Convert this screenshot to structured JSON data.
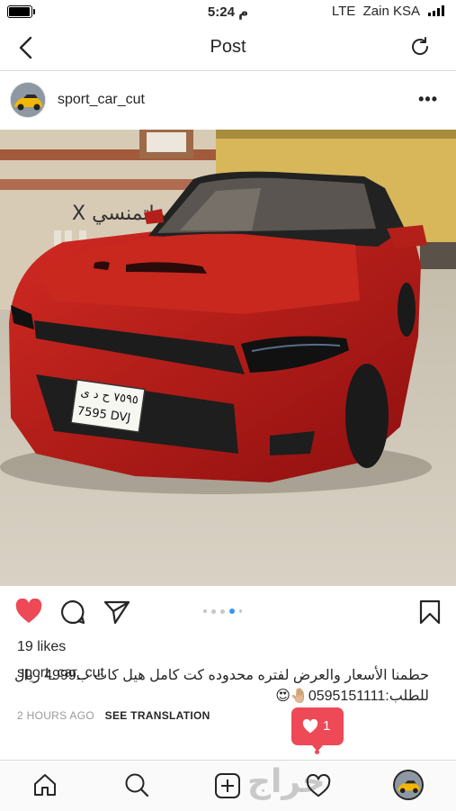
{
  "status_bar": {
    "time": "5:24 م",
    "network": "LTE",
    "carrier": "Zain KSA",
    "battery_level": 0.9
  },
  "nav": {
    "title": "Post",
    "back_icon": "chevron-left-icon",
    "refresh_icon": "refresh-icon"
  },
  "post": {
    "username": "sport_car_cut",
    "photo_plate_text": "٧٥٩٥ ح د ى",
    "photo_plate_number": "7595 DVJ",
    "photo_wall_text": "X ماتمنسي",
    "likes": "19 likes",
    "caption_user": "sport_car_cut",
    "caption_text": "حطمنا الأسعار والعرض لفتره محدوده كت كامل هيل كات ب4999 ريال للطلب:0595151111🤚🏼😍",
    "time_ago": "2 HOURS AGO",
    "translation_link": "SEE TRANSLATION",
    "carousel_total": 5,
    "carousel_active": 3,
    "liked": true
  },
  "notification": {
    "count": "1",
    "icon": "heart-icon"
  },
  "tabbar": {
    "items": [
      "home-icon",
      "search-icon",
      "add-post-icon",
      "activity-heart-icon",
      "profile-avatar"
    ],
    "watermark": "حراج"
  },
  "colors": {
    "like_red": "#ed4956",
    "carousel_active": "#3897f0",
    "text": "#262626",
    "meta_gray": "#999999"
  }
}
